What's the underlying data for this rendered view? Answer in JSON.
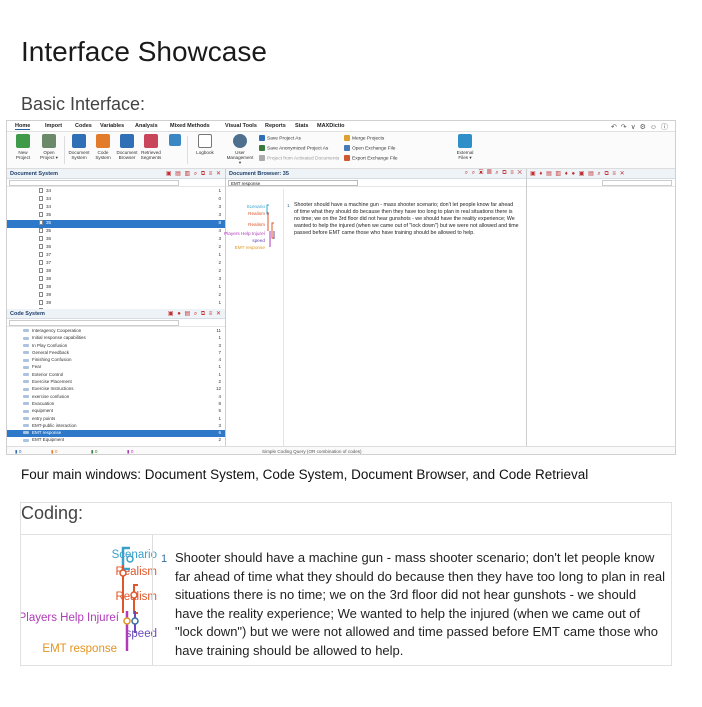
{
  "page": {
    "title": "Interface Showcase",
    "basic_heading": "Basic Interface:",
    "caption": "Four main windows: Document System, Code System, Document Browser, and Code Retrieval",
    "coding_heading": "Coding:"
  },
  "app": {
    "menu_tabs": [
      "Home",
      "Import",
      "Codes",
      "Variables",
      "Analysis",
      "Mixed Methods",
      "Visual Tools",
      "Reports",
      "Stats",
      "MAXDictio"
    ],
    "menu_right": "↶ ↷  ∨ ⚙ ☺ ⓘ",
    "ribbon": {
      "new_project": "New Project",
      "open_project": "Open Project ▾",
      "document_system": "Document System",
      "code_system": "Code System",
      "document_browser": "Document Browser",
      "retrieved_segments": "Retrieved Segments",
      "logbook": "Logbook",
      "user_management": "User Management ▾",
      "save_project_as": "Save Project As",
      "save_anonymized": "Save Anonymized Project As",
      "project_from_docs": "Project from Activated Documents",
      "merge_projects": "Merge Projects",
      "open_exchange": "Open Exchange File",
      "export_exchange": "Export Exchange File",
      "external_files": "External Files ▾"
    },
    "document_system": {
      "title": "Document System",
      "rows": [
        {
          "label": "34",
          "count": "1"
        },
        {
          "label": "34",
          "count": "0"
        },
        {
          "label": "34",
          "count": "3"
        },
        {
          "label": "35",
          "count": "3"
        },
        {
          "label": "35",
          "count": "8",
          "selected": true
        },
        {
          "label": "35",
          "count": "4"
        },
        {
          "label": "36",
          "count": "3"
        },
        {
          "label": "36",
          "count": "2"
        },
        {
          "label": "37",
          "count": "1"
        },
        {
          "label": "37",
          "count": "2"
        },
        {
          "label": "38",
          "count": "2"
        },
        {
          "label": "38",
          "count": "3"
        },
        {
          "label": "38",
          "count": "1"
        },
        {
          "label": "39",
          "count": "2"
        },
        {
          "label": "39",
          "count": "1"
        },
        {
          "label": "40",
          "count": "4"
        }
      ]
    },
    "code_system": {
      "title": "Code System",
      "rows": [
        {
          "label": "Interagency Cooperation",
          "count": "11"
        },
        {
          "label": "Initial response capabilities",
          "count": "1"
        },
        {
          "label": "In Play Confusion",
          "count": "3"
        },
        {
          "label": "General Feedback",
          "count": "7"
        },
        {
          "label": "Finishing Confusion",
          "count": "4"
        },
        {
          "label": "Fear",
          "count": "1"
        },
        {
          "label": "Exterior Control",
          "count": "1"
        },
        {
          "label": "Exercise Placement",
          "count": "2"
        },
        {
          "label": "Exercise Instructions",
          "count": "12"
        },
        {
          "label": "exercise confusion",
          "count": "4"
        },
        {
          "label": "Evacuation",
          "count": "8"
        },
        {
          "label": "equipment",
          "count": "5"
        },
        {
          "label": "entry points",
          "count": "1"
        },
        {
          "label": "EMT-public interaction",
          "count": "3"
        },
        {
          "label": "EMT response",
          "count": "6",
          "selected": true
        },
        {
          "label": "EMT Equipment",
          "count": "2"
        }
      ]
    },
    "document_browser": {
      "title": "Document Browser: 35",
      "selector": "EMT response",
      "line_number": "1",
      "labels": [
        "Scenario",
        "Realism",
        "Realism",
        "Players Help Injureí",
        "speed",
        "EMT response"
      ]
    },
    "status_bar": {
      "docs": "0",
      "codes": "0",
      "a": "0",
      "b": "0",
      "query": "Simple Coding Query (OR combination of codes)"
    }
  },
  "coding": {
    "line_number": "1",
    "text": "Shooter should have a machine gun - mass shooter scenario; don't let people know far ahead of time what they should do because then they have too long to plan in real situations there is no time; we on the 3rd floor did not hear gunshots - we should have the reality experience; We wanted to help the injured (when we came out of \"lock down\") but we were not allowed and time passed before EMT came those who have training should be allowed to help.",
    "labels": {
      "scenario": "Scenario",
      "realism1": "Realism",
      "realism2": "Realism",
      "players": "Players Help Injureí",
      "speed": "speed",
      "emt": "EMT response"
    }
  },
  "colors": {
    "scenario": "#3aa0c8",
    "realism": "#e0552a",
    "players": "#b03ab8",
    "speed": "#6a4ab8",
    "emt": "#e29420",
    "selection": "#2d78c8"
  }
}
